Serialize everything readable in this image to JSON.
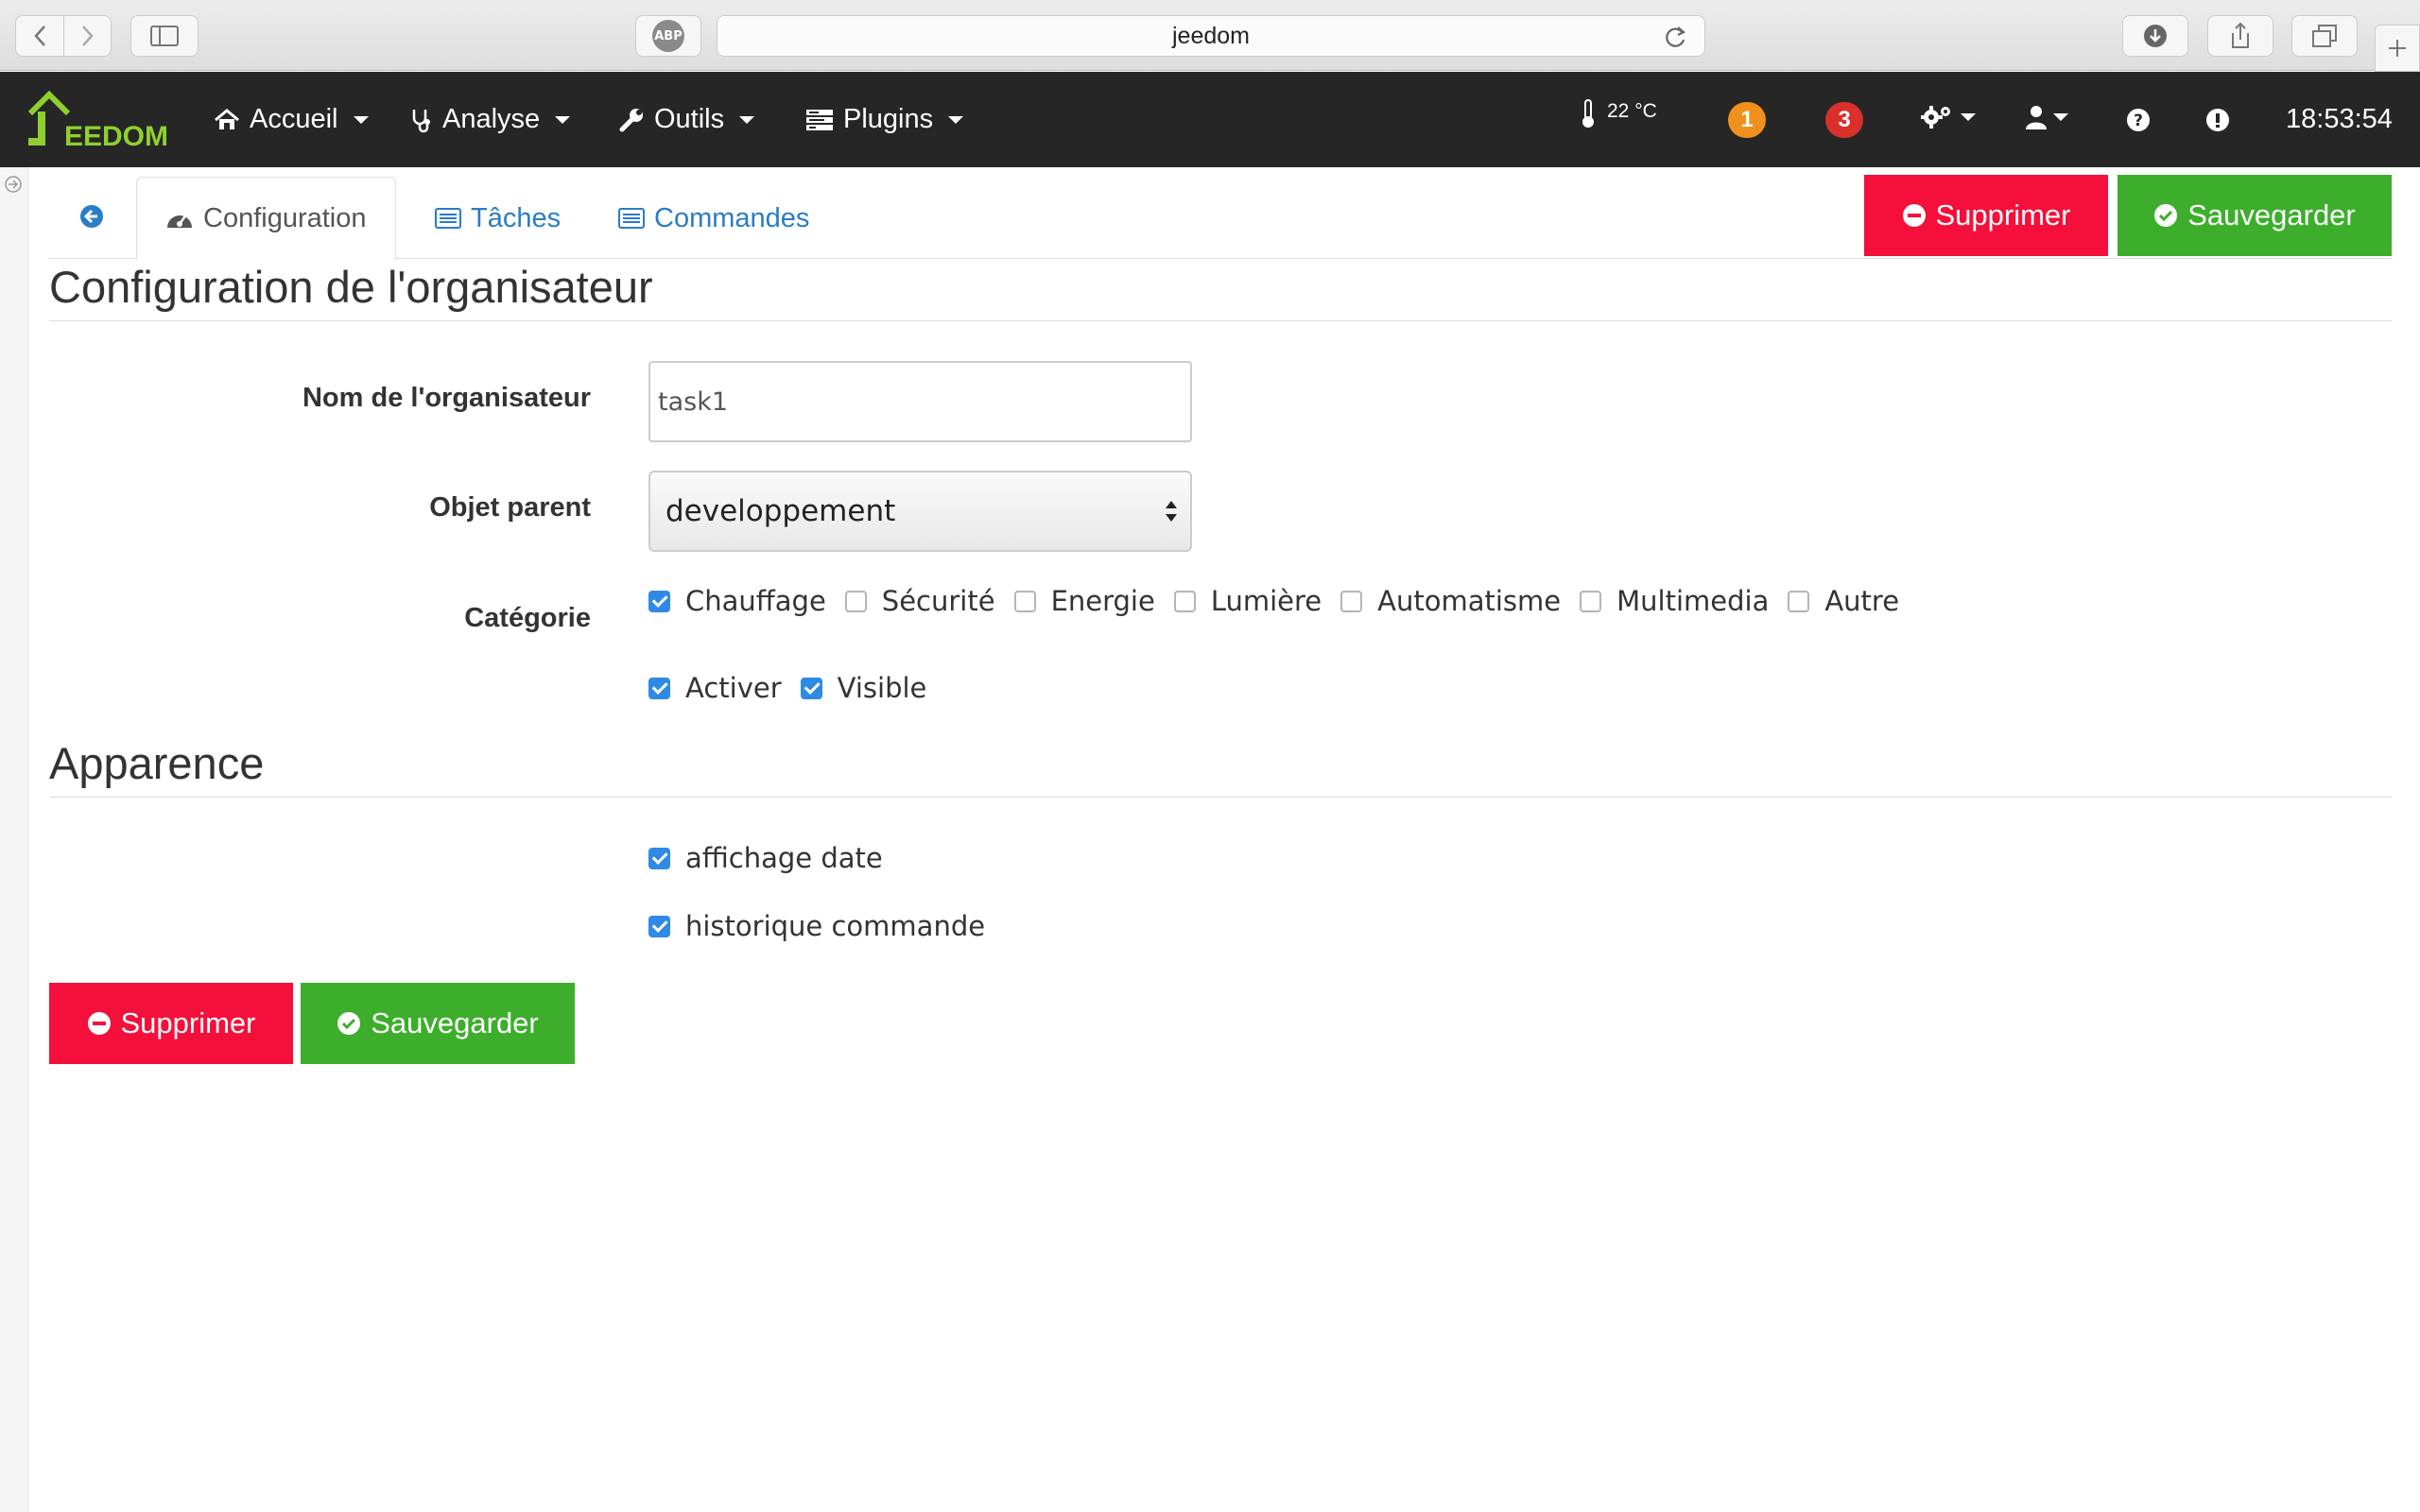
{
  "browser": {
    "url": "jeedom"
  },
  "navbar": {
    "menus": [
      {
        "label": "Accueil",
        "icon": "home-icon"
      },
      {
        "label": "Analyse",
        "icon": "stethoscope-icon"
      },
      {
        "label": "Outils",
        "icon": "wrench-icon"
      },
      {
        "label": "Plugins",
        "icon": "tasks-icon"
      }
    ],
    "temperature": "22 °C",
    "badge_orange": "1",
    "badge_red": "3",
    "time": "18:53:54",
    "colors": {
      "bg": "#262626",
      "badge_orange": "#f0911d",
      "badge_red": "#d9302a"
    }
  },
  "tabs": {
    "items": [
      {
        "label": "Configuration",
        "icon": "dashboard-icon",
        "active": true
      },
      {
        "label": "Tâches",
        "icon": "list-icon"
      },
      {
        "label": "Commandes",
        "icon": "list-icon"
      }
    ]
  },
  "actions": {
    "delete_label": "Supprimer",
    "save_label": "Sauvegarder"
  },
  "config": {
    "legend": "Configuration de l'organisateur",
    "name_label": "Nom de l'organisateur",
    "name_value": "task1",
    "parent_label": "Objet parent",
    "parent_value": "developpement",
    "category_label": "Catégorie",
    "categories": [
      {
        "label": "Chauffage",
        "checked": true
      },
      {
        "label": "Sécurité",
        "checked": false
      },
      {
        "label": "Energie",
        "checked": false
      },
      {
        "label": "Lumière",
        "checked": false
      },
      {
        "label": "Automatisme",
        "checked": false
      },
      {
        "label": "Multimedia",
        "checked": false
      },
      {
        "label": "Autre",
        "checked": false
      }
    ],
    "enable_label": "Activer",
    "visible_label": "Visible"
  },
  "appearance": {
    "legend": "Apparence",
    "show_date_label": "affichage date",
    "history_label": "historique commande"
  }
}
